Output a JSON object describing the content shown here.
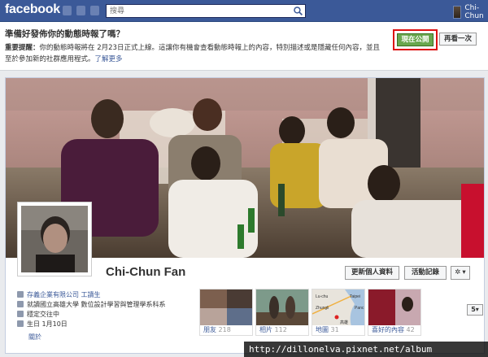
{
  "topbar": {
    "logo": "facebook",
    "search_placeholder": "搜尋",
    "user_name": "Chi-Chun"
  },
  "notice": {
    "title": "準備好發佈你的動態時報了嗎？",
    "warning_label": "重要提醒：",
    "warning_text": "你的動態時報將在 2月23日正式上線。這讓你有機會查看動態時報上的內容，特別描述或是隱藏任何內容，並且",
    "line2_text": "至於參加新的社群應用程式。",
    "learn_more": "了解更多",
    "publish_label": "現在公開",
    "later_label": "再看一次"
  },
  "profile": {
    "name": "Chi-Chun Fan",
    "update_info_label": "更新個人資料",
    "activity_log_label": "活動記錄",
    "gear_label": "✲",
    "info": [
      {
        "text": "存義企業有限公司 工讀生",
        "icon": "briefcase-icon"
      },
      {
        "text": "就讀國立高雄大學 數位設計學習與管理學系科系",
        "icon": "school-icon"
      },
      {
        "text": "穩定交往中",
        "icon": "heart-icon"
      },
      {
        "text": "生日 1月10日",
        "icon": "birthday-icon"
      }
    ],
    "about_label": "關於"
  },
  "tiles": [
    {
      "label": "朋友",
      "count": "218"
    },
    {
      "label": "相片",
      "count": "112"
    },
    {
      "label": "地圖",
      "count": "31"
    },
    {
      "label": "喜好的內容",
      "count": "42"
    }
  ],
  "map_labels": {
    "a": "Lu-chu",
    "b": "Taipei",
    "c": "Zhungli",
    "d": "Panc",
    "e": "高雄"
  },
  "apps_count": "5",
  "watermark": "http://dillonelva.pixnet.net/album"
}
